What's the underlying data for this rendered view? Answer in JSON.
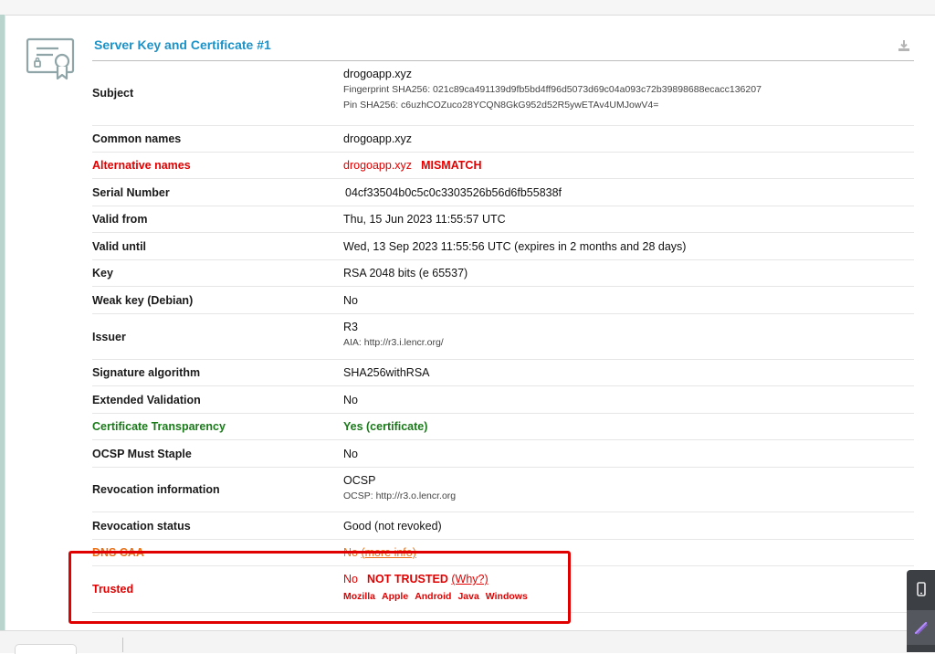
{
  "section": {
    "title": "Server Key and Certificate #1",
    "icon": "certificate-icon",
    "download_icon": "download-icon"
  },
  "rows": {
    "subject": {
      "label": "Subject",
      "value": "drogoapp.xyz",
      "fingerprint": "Fingerprint SHA256: 021c89ca491139d9fb5bd4ff96d5073d69c04a093c72b39898688ecacc136207",
      "pin": "Pin SHA256: c6uzhCOZuco28YCQN8GkG952d52R5ywETAv4UMJowV4="
    },
    "common_names": {
      "label": "Common names",
      "value": "drogoapp.xyz"
    },
    "alternative_names": {
      "label": "Alternative names",
      "value": "drogoapp.xyz",
      "flag": "MISMATCH"
    },
    "serial_number": {
      "label": "Serial Number",
      "value": "04cf33504b0c5c0c3303526b56d6fb55838f"
    },
    "valid_from": {
      "label": "Valid from",
      "value": "Thu, 15 Jun 2023 11:55:57 UTC"
    },
    "valid_until": {
      "label": "Valid until",
      "value": "Wed, 13 Sep 2023 11:55:56 UTC (expires in 2 months and 28 days)"
    },
    "key": {
      "label": "Key",
      "value": "RSA 2048 bits (e 65537)"
    },
    "weak_key": {
      "label": "Weak key (Debian)",
      "value": "No"
    },
    "issuer": {
      "label": "Issuer",
      "value": "R3",
      "aia": "AIA: http://r3.i.lencr.org/"
    },
    "signature_algorithm": {
      "label": "Signature algorithm",
      "value": "SHA256withRSA"
    },
    "extended_validation": {
      "label": "Extended Validation",
      "value": "No"
    },
    "certificate_transparency": {
      "label": "Certificate Transparency",
      "value": "Yes (certificate)"
    },
    "ocsp_must_staple": {
      "label": "OCSP Must Staple",
      "value": "No"
    },
    "revocation_information": {
      "label": "Revocation information",
      "value": "OCSP",
      "ocsp": "OCSP: http://r3.o.lencr.org"
    },
    "revocation_status": {
      "label": "Revocation status",
      "value": "Good (not revoked)"
    },
    "dns_caa": {
      "label": "DNS CAA",
      "value": "No",
      "link": "(more info)"
    },
    "trusted": {
      "label": "Trusted",
      "value": "No",
      "flag": "NOT TRUSTED",
      "link": "(Why?)",
      "clients": [
        "Mozilla",
        "Apple",
        "Android",
        "Java",
        "Windows"
      ]
    }
  },
  "colors": {
    "title": "#1c93c8",
    "error": "#e30000",
    "ok": "#1a7a1a",
    "warning": "#e8741d",
    "highlight_box": "#e00000"
  },
  "side_panel": {
    "icons": [
      "phone-icon",
      "pen-icon"
    ]
  }
}
